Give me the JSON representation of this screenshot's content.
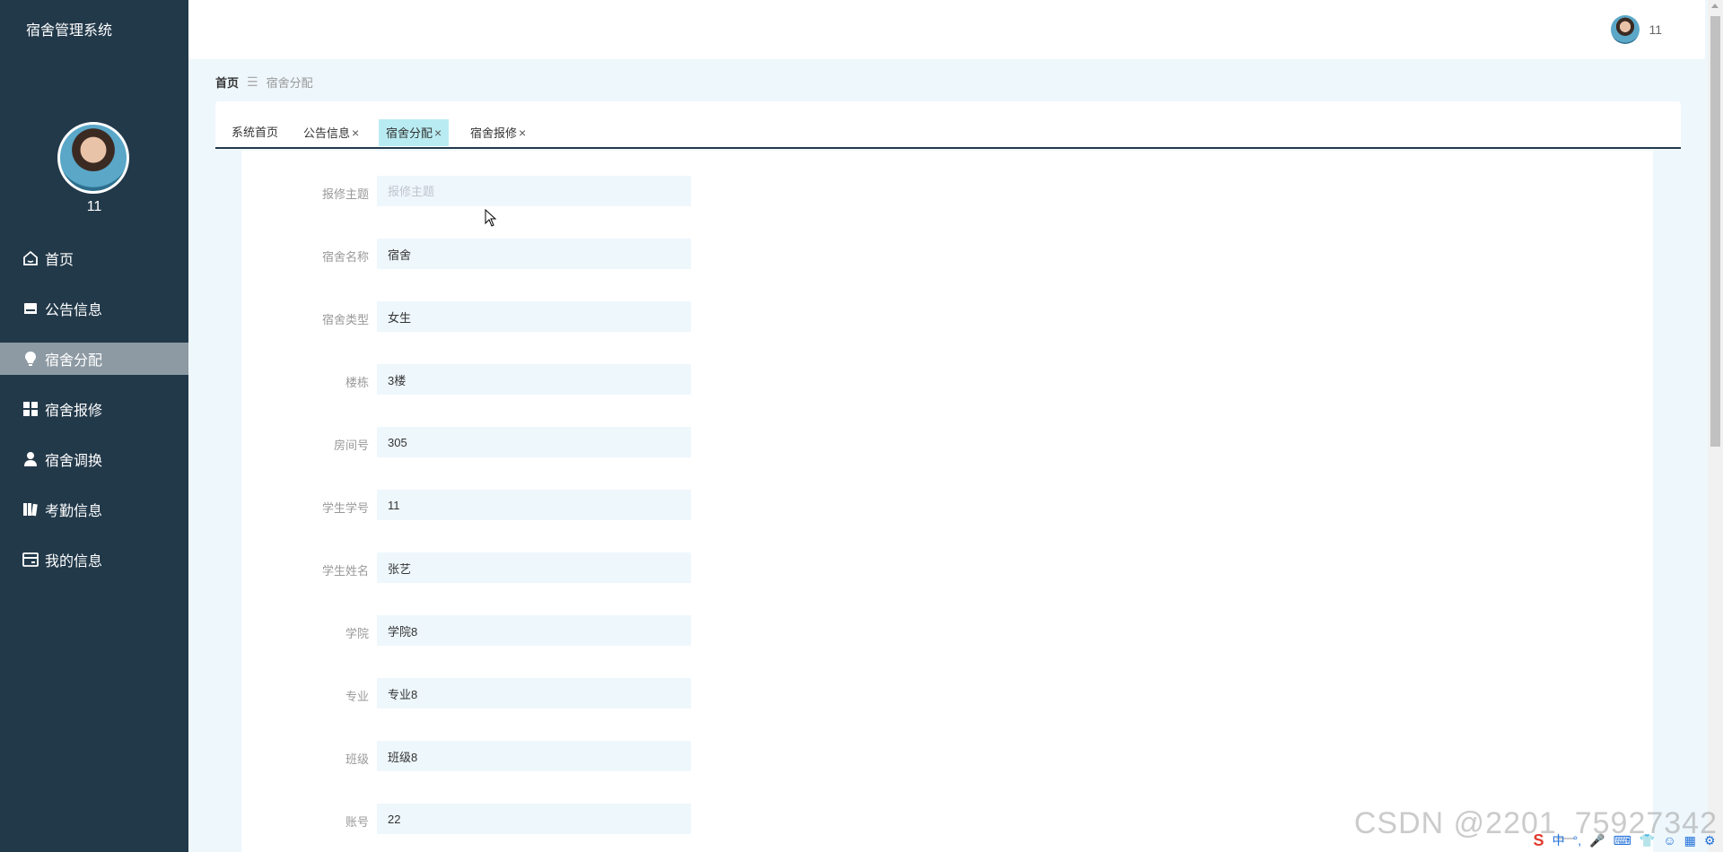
{
  "app": {
    "title": "宿舍管理系统"
  },
  "sidebar": {
    "username": "11",
    "items": [
      {
        "label": "首页",
        "icon": "home-icon"
      },
      {
        "label": "公告信息",
        "icon": "inbox-icon"
      },
      {
        "label": "宿舍分配",
        "icon": "bulb-icon",
        "active": true
      },
      {
        "label": "宿舍报修",
        "icon": "grid-icon"
      },
      {
        "label": "宿舍调换",
        "icon": "user-icon"
      },
      {
        "label": "考勤信息",
        "icon": "book-icon"
      },
      {
        "label": "我的信息",
        "icon": "card-icon"
      }
    ]
  },
  "header": {
    "username": "11"
  },
  "breadcrumb": {
    "home": "首页",
    "separator": "☰",
    "current": "宿舍分配"
  },
  "tabs": [
    {
      "label": "系统首页"
    },
    {
      "label": "公告信息",
      "close": "×"
    },
    {
      "label": "宿舍分配",
      "close": "×",
      "active": true
    },
    {
      "label": "宿舍报修",
      "close": "×"
    }
  ],
  "form": {
    "fields": [
      {
        "label": "报修主题",
        "value": "",
        "placeholder": "报修主题"
      },
      {
        "label": "宿舍名称",
        "value": "宿舍"
      },
      {
        "label": "宿舍类型",
        "value": "女生"
      },
      {
        "label": "楼栋",
        "value": "3楼"
      },
      {
        "label": "房间号",
        "value": "305"
      },
      {
        "label": "学生学号",
        "value": "11"
      },
      {
        "label": "学生姓名",
        "value": "张艺"
      },
      {
        "label": "学院",
        "value": "学院8"
      },
      {
        "label": "专业",
        "value": "专业8"
      },
      {
        "label": "班级",
        "value": "班级8"
      },
      {
        "label": "账号",
        "value": "22"
      }
    ]
  },
  "watermark": "CSDN @2201_75927342",
  "tray": {
    "logo": "S",
    "ime": "中"
  },
  "colors": {
    "sidebar": "#22394a",
    "active_menu": "#8d9aa3",
    "active_tab": "#b9ecf2",
    "input_bg": "#eef7fc"
  }
}
